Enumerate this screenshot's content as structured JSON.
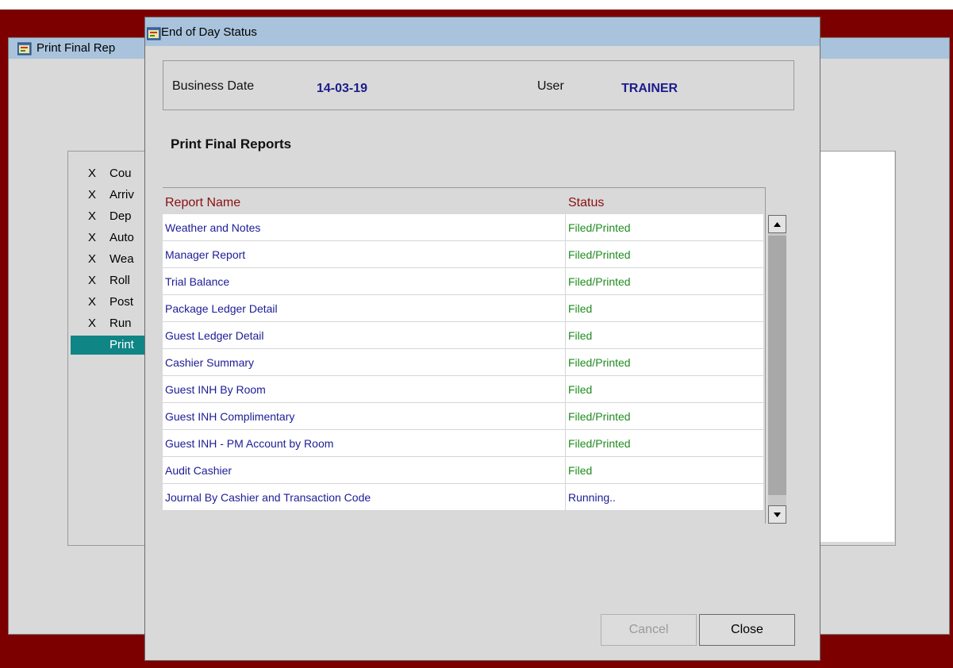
{
  "background_window": {
    "title": "Print Final Rep",
    "steps": [
      {
        "mark": "X",
        "label": "Cou"
      },
      {
        "mark": "X",
        "label": "Arriv"
      },
      {
        "mark": "X",
        "label": "Dep"
      },
      {
        "mark": "X",
        "label": "Auto"
      },
      {
        "mark": "X",
        "label": "Wea"
      },
      {
        "mark": "X",
        "label": "Roll"
      },
      {
        "mark": "X",
        "label": "Post"
      },
      {
        "mark": "X",
        "label": "Run"
      },
      {
        "mark": "",
        "label": "Print"
      }
    ]
  },
  "dialog": {
    "title": "End of Day Status",
    "business_date_label": "Business Date",
    "business_date_value": "14-03-19",
    "user_label": "User",
    "user_value": "TRAINER",
    "section_title": "Print Final Reports",
    "columns": {
      "name": "Report Name",
      "status": "Status"
    },
    "reports": [
      {
        "name": "Weather and Notes",
        "status": "Filed/Printed"
      },
      {
        "name": "Manager Report",
        "status": "Filed/Printed"
      },
      {
        "name": "Trial Balance",
        "status": "Filed/Printed"
      },
      {
        "name": "Package Ledger Detail",
        "status": "Filed"
      },
      {
        "name": "Guest Ledger Detail",
        "status": "Filed"
      },
      {
        "name": "Cashier Summary",
        "status": "Filed/Printed"
      },
      {
        "name": "Guest INH By Room",
        "status": "Filed"
      },
      {
        "name": "Guest INH Complimentary",
        "status": "Filed/Printed"
      },
      {
        "name": "Guest INH - PM Account by Room",
        "status": "Filed/Printed"
      },
      {
        "name": "Audit Cashier",
        "status": "Filed"
      },
      {
        "name": "Journal By Cashier and Transaction Code",
        "status": "Running.."
      }
    ],
    "buttons": {
      "cancel": "Cancel",
      "close": "Close"
    }
  },
  "colors": {
    "desktop": "#7d0000",
    "titlebar": "#a9c3dc",
    "report_name": "#1c1c96",
    "status_done": "#1e8c1e",
    "header_text": "#8b0f12",
    "selection": "#0f8585"
  },
  "icons": {
    "app_icon": "app-window-icon",
    "scroll_up": "arrow-up-icon",
    "scroll_down": "arrow-down-icon"
  }
}
